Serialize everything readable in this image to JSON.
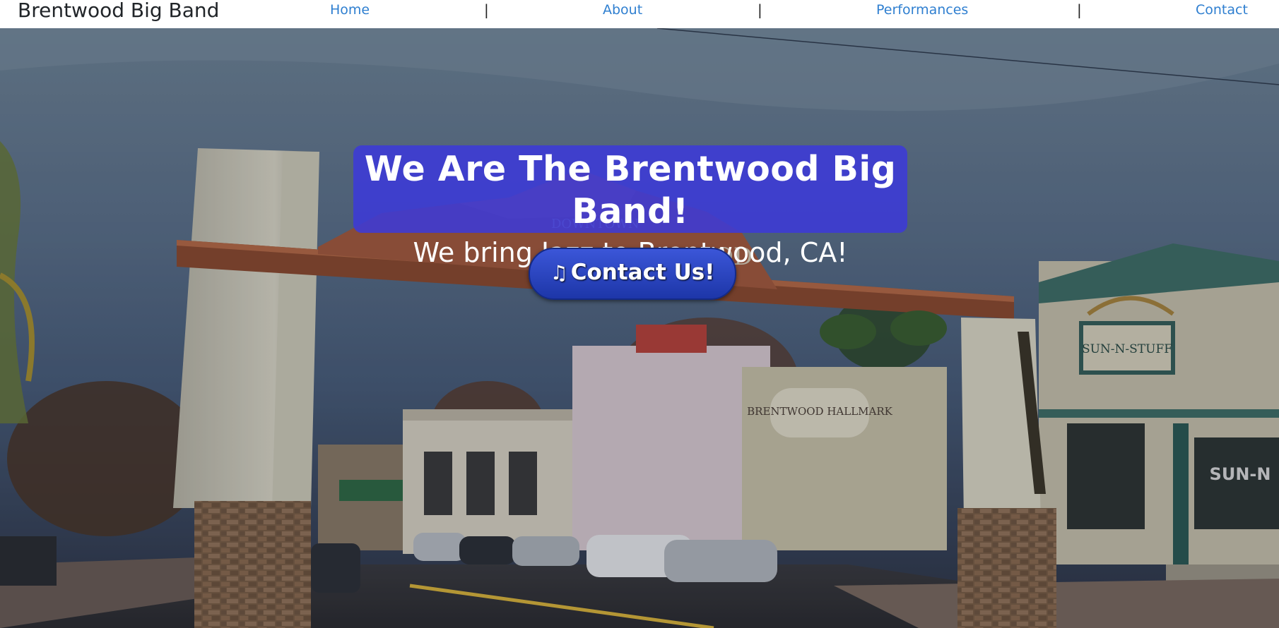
{
  "navbar": {
    "brand": "Brentwood Big Band",
    "links": [
      "Home",
      "About",
      "Performances",
      "Contact"
    ],
    "separator": "|"
  },
  "hero": {
    "headline": "We Are The Brentwood Big Band!",
    "subheadline": "We bring Jazz to Brentwood, CA!",
    "button_icon": "♫",
    "button_icon_name": "music-note-icon",
    "button_label": "Contact Us!",
    "background_image": "downtown-brentwood-arch-photo",
    "sign_text": "SUN-N-STUFF",
    "store_sign_text": "BRENTWOOD HALLMARK"
  },
  "colors": {
    "link": "#2f7fd0",
    "headline_box": "#3c3ad7",
    "button": "#2a45c6"
  }
}
